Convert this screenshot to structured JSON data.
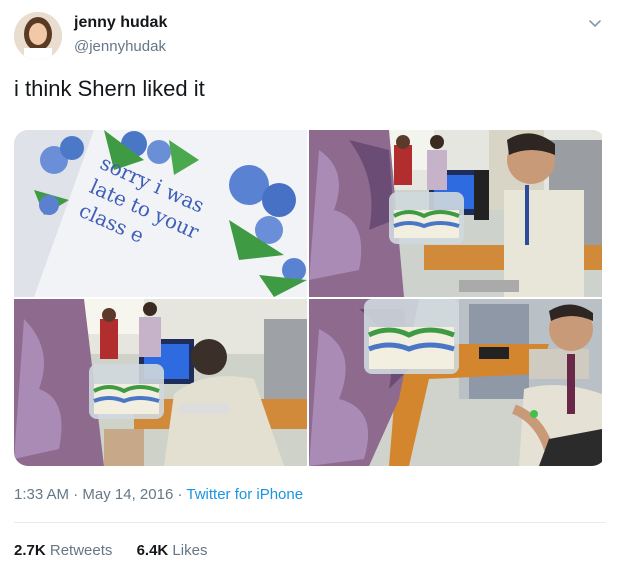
{
  "user": {
    "name": "jenny hudak",
    "handle": "@jennyhudak"
  },
  "tweet": {
    "text": "i think Shern liked it"
  },
  "media": {
    "cake_text_lines": [
      "sorry i was",
      "late to your",
      "class e"
    ],
    "photos": [
      "cake-closeup",
      "student-holding-cake",
      "teacher-at-computer",
      "teacher-smiling"
    ]
  },
  "meta": {
    "time": "1:33 AM",
    "separator1": " · ",
    "date": "May 14, 2016",
    "separator2": " · ",
    "client": "Twitter for iPhone"
  },
  "stats": {
    "retweets_count": "2.7K",
    "retweets_label": "Retweets",
    "likes_count": "6.4K",
    "likes_label": "Likes"
  },
  "colors": {
    "link": "#1b95e0",
    "secondary": "#657786",
    "text": "#14171a"
  },
  "icons": [
    "chevron-down-icon"
  ]
}
